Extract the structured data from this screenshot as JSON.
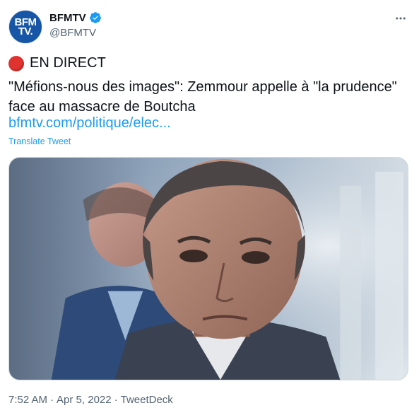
{
  "account": {
    "avatar_line1": "BFM",
    "avatar_line2": "TV.",
    "display_name": "BFMTV",
    "handle": "@BFMTV"
  },
  "tweet": {
    "live_label": "EN DIRECT",
    "text": "\"Méfions-nous des images\": Zemmour appelle à \"la prudence\" face au massacre de Boutcha",
    "link": "bfmtv.com/politique/elec...",
    "translate": "Translate Tweet",
    "time": "7:52 AM",
    "separator1": "·",
    "date": "Apr 5, 2022",
    "separator2": "·",
    "source": "TweetDeck"
  },
  "icons": {
    "more": "more-options-icon",
    "verified": "verified-badge-icon",
    "live": "red-circle-icon"
  },
  "colors": {
    "link": "#1d9bf0",
    "verified": "#1d9bf0",
    "live_dot": "#e0322e",
    "secondary_text": "#536471"
  }
}
